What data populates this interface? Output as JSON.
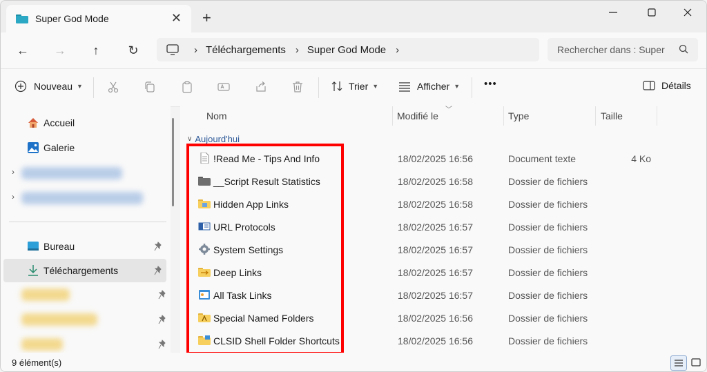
{
  "window": {
    "tab_title": "Super God Mode",
    "tab_close": "✕",
    "new_tab": "+",
    "minimize": "—",
    "maximize": "☐",
    "close": "✕"
  },
  "nav": {
    "back": "←",
    "forward": "→",
    "up": "↑",
    "refresh": "↻"
  },
  "breadcrumb": [
    "Téléchargements",
    "Super God Mode"
  ],
  "search": {
    "placeholder": "Rechercher dans : Super God Mode"
  },
  "toolbar": {
    "new_label": "Nouveau",
    "sort_label": "Trier",
    "view_label": "Afficher",
    "more_label": "•••",
    "details_label": "Détails"
  },
  "sidebar": {
    "items": [
      {
        "label": "Accueil",
        "icon": "home-icon"
      },
      {
        "label": "Galerie",
        "icon": "gallery-icon"
      },
      {
        "label": "Bureau",
        "icon": "desktop-icon",
        "pinned": true
      },
      {
        "label": "Téléchargements",
        "icon": "download-icon",
        "pinned": true,
        "selected": true
      }
    ]
  },
  "columns": {
    "name": "Nom",
    "modified": "Modifié le",
    "type": "Type",
    "size": "Taille"
  },
  "group_label": "Aujourd'hui",
  "files": [
    {
      "name": "!Read Me - Tips And Info",
      "date": "18/02/2025 16:56",
      "type": "Document texte",
      "size": "4 Ko",
      "icon": "text-document-icon"
    },
    {
      "name": "__Script Result Statistics",
      "date": "18/02/2025 16:58",
      "type": "Dossier de fichiers",
      "size": "",
      "icon": "dark-folder-icon"
    },
    {
      "name": "Hidden App Links",
      "date": "18/02/2025 16:58",
      "type": "Dossier de fichiers",
      "size": "",
      "icon": "app-folder-icon"
    },
    {
      "name": "URL Protocols",
      "date": "18/02/2025 16:57",
      "type": "Dossier de fichiers",
      "size": "",
      "icon": "url-icon"
    },
    {
      "name": "System Settings",
      "date": "18/02/2025 16:57",
      "type": "Dossier de fichiers",
      "size": "",
      "icon": "settings-gear-icon"
    },
    {
      "name": "Deep Links",
      "date": "18/02/2025 16:57",
      "type": "Dossier de fichiers",
      "size": "",
      "icon": "link-folder-icon"
    },
    {
      "name": "All Task Links",
      "date": "18/02/2025 16:57",
      "type": "Dossier de fichiers",
      "size": "",
      "icon": "task-window-icon"
    },
    {
      "name": "Special Named Folders",
      "date": "18/02/2025 16:56",
      "type": "Dossier de fichiers",
      "size": "",
      "icon": "named-folder-icon"
    },
    {
      "name": "CLSID Shell Folder Shortcuts",
      "date": "18/02/2025 16:56",
      "type": "Dossier de fichiers",
      "size": "",
      "icon": "shell-folder-icon"
    }
  ],
  "status": {
    "count": "9 élément(s)"
  },
  "colors": {
    "highlight": "#ff0000",
    "group_text": "#2b5797",
    "selected_bg": "#e5e5e5"
  }
}
